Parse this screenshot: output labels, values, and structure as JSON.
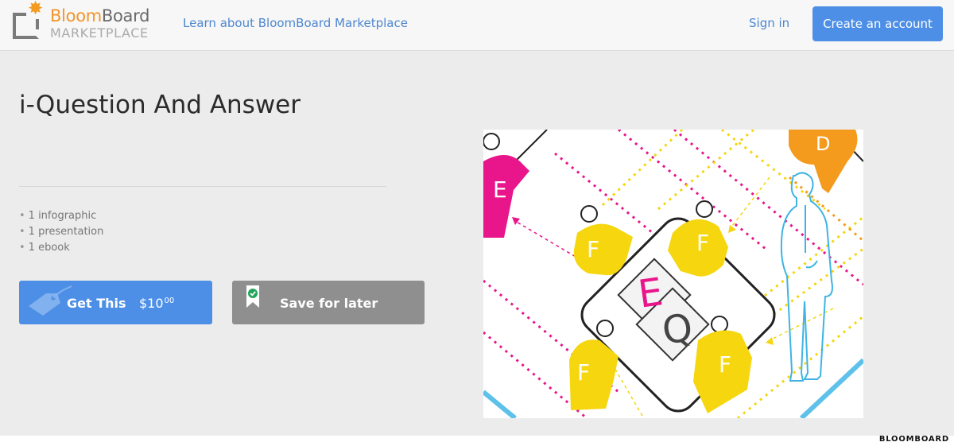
{
  "header": {
    "logo_line1_a": "Bloom",
    "logo_line1_b": "Board",
    "logo_line2": "MARKETPLACE",
    "learn_link": "Learn about BloomBoard Marketplace",
    "signin_link": "Sign in",
    "create_button": "Create an account"
  },
  "product": {
    "title": "i-Question And Answer",
    "includes": [
      "1 infographic",
      "1 presentation",
      "1 ebook"
    ],
    "get_label": "Get This",
    "price_main": "$10",
    "price_cents": "00",
    "save_label": "Save for later"
  },
  "illustration": {
    "letters": [
      "E",
      "F",
      "F",
      "F",
      "F",
      "E",
      "Q",
      "D"
    ]
  },
  "watermark": "BLOOMBOARD",
  "colors": {
    "accent_blue": "#4d8fe6",
    "link_blue": "#4d86cf",
    "logo_orange": "#f2952a",
    "save_gray": "#8f8f8f",
    "figure_yellow": "#f5d60f",
    "figure_magenta": "#e8158b",
    "figure_orange": "#f49a1d",
    "figure_outline_blue": "#3fb4e4"
  },
  "icons": [
    "logo-mark-icon",
    "price-tag-icon",
    "bookmark-check-icon"
  ]
}
